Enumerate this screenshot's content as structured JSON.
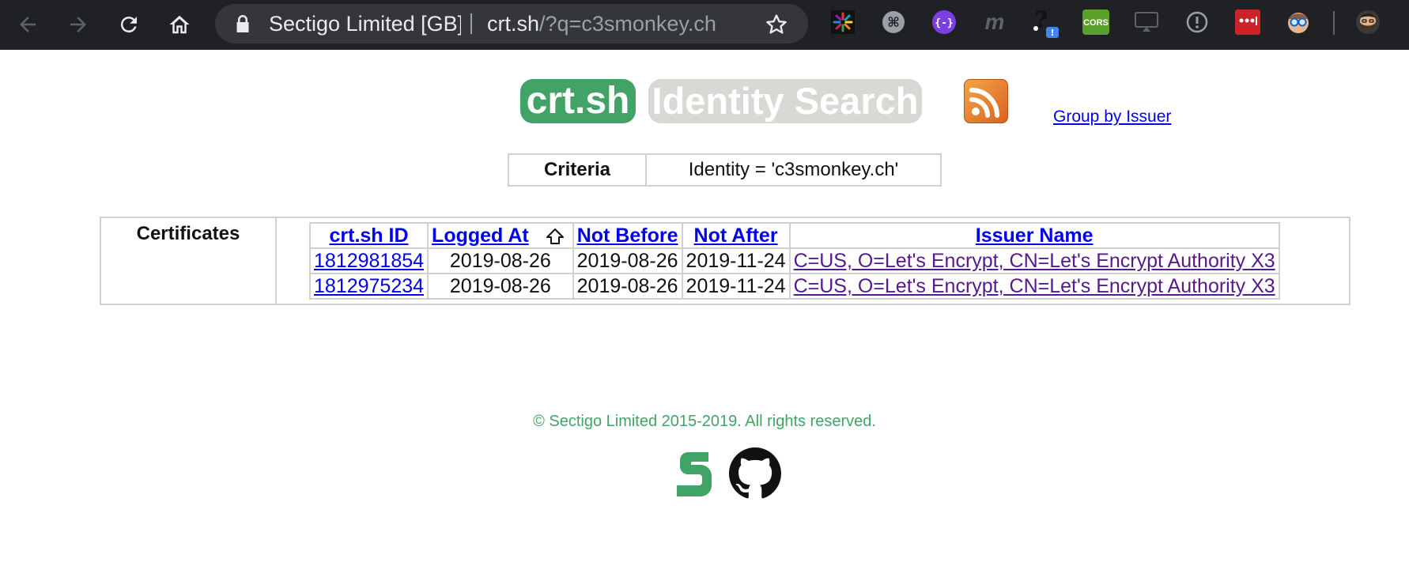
{
  "browser": {
    "site_name": "Sectigo Limited [GB]",
    "url_host": "crt.sh",
    "url_path": "/?q=c3smonkey.ch",
    "extensions": [
      "colorful-burst-extension",
      "command-extension",
      "json-extension",
      "m-extension",
      "badge-question-extension",
      "cors-extension",
      "cast-extension",
      "info-extension",
      "lastpass-extension",
      "glasses-avatar-extension",
      "profile-avatar"
    ],
    "cors_label": "CORS",
    "badge_count": "!"
  },
  "page": {
    "logo_main": "crt.sh",
    "logo_sub": "Identity Search",
    "group_link": "Group by Issuer",
    "criteria_label": "Criteria",
    "criteria_value": "Identity = 'c3smonkey.ch'",
    "certificates_label": "Certificates"
  },
  "table": {
    "headers": [
      "crt.sh ID",
      "Logged At",
      "Not Before",
      "Not After",
      "Issuer Name"
    ],
    "sorted_by": "Logged At",
    "rows": [
      {
        "id": "1812981854",
        "logged_at": "2019-08-26",
        "not_before": "2019-08-26",
        "not_after": "2019-11-24",
        "issuer": "C=US, O=Let's Encrypt, CN=Let's Encrypt Authority X3"
      },
      {
        "id": "1812975234",
        "logged_at": "2019-08-26",
        "not_before": "2019-08-26",
        "not_after": "2019-11-24",
        "issuer": "C=US, O=Let's Encrypt, CN=Let's Encrypt Authority X3"
      }
    ]
  },
  "footer": {
    "copyright": "© Sectigo Limited 2015-2019. All rights reserved."
  },
  "colors": {
    "brand_green": "#41a466",
    "link_blue": "#0000ee",
    "visited_purple": "#551a8b",
    "toolbar_bg": "#202124"
  }
}
